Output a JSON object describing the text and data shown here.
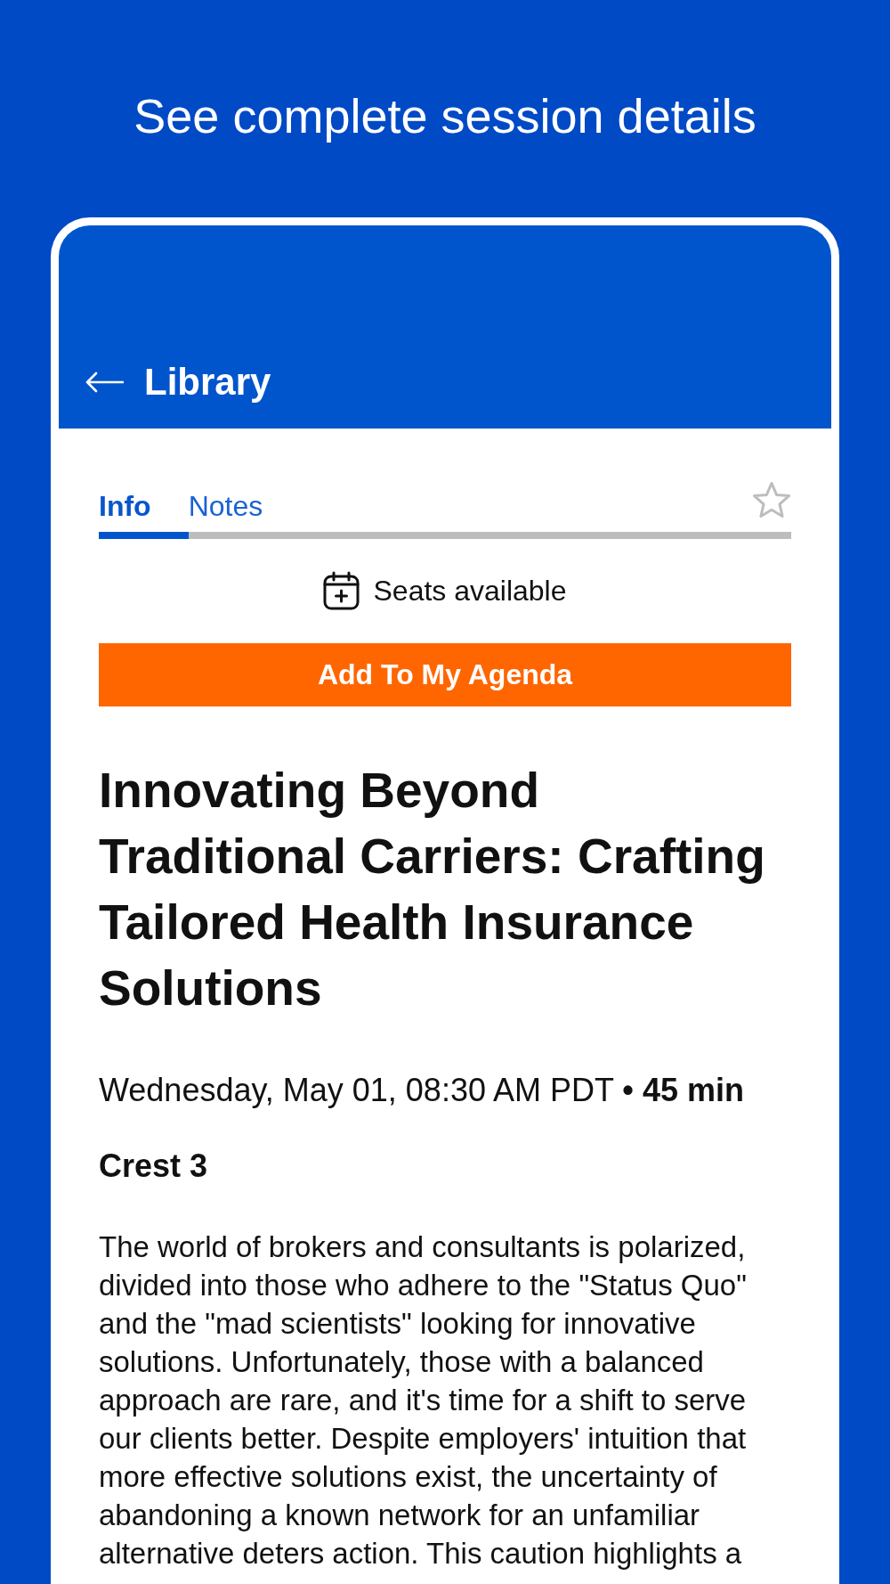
{
  "heading": "See complete session details",
  "header": {
    "back_label": "Library"
  },
  "tabs": [
    {
      "label": "Info",
      "selected": true
    },
    {
      "label": "Notes",
      "selected": false
    }
  ],
  "favorite": {
    "on": false
  },
  "availability": {
    "text": "Seats available"
  },
  "primary_button": {
    "label": "Add To My Agenda"
  },
  "session": {
    "title": "Innovating Beyond Traditional Carriers: Crafting Tailored Health Insurance Solutions",
    "datetime": "Wednesday, May 01, 08:30 AM PDT **• 45 min**",
    "location": "Crest 3",
    "description": "The world of brokers and consultants is polarized, divided into those who adhere to the \"Status Quo\" and the \"mad scientists\" looking for innovative solutions. Unfortunately, those with a balanced approach are rare, and it's time for a shift to serve our clients better. Despite employers' intuition that more effective solutions exist, the uncertainty of abandoning a known network for an unfamiliar alternative deters action. This caution highlights a"
  }
}
